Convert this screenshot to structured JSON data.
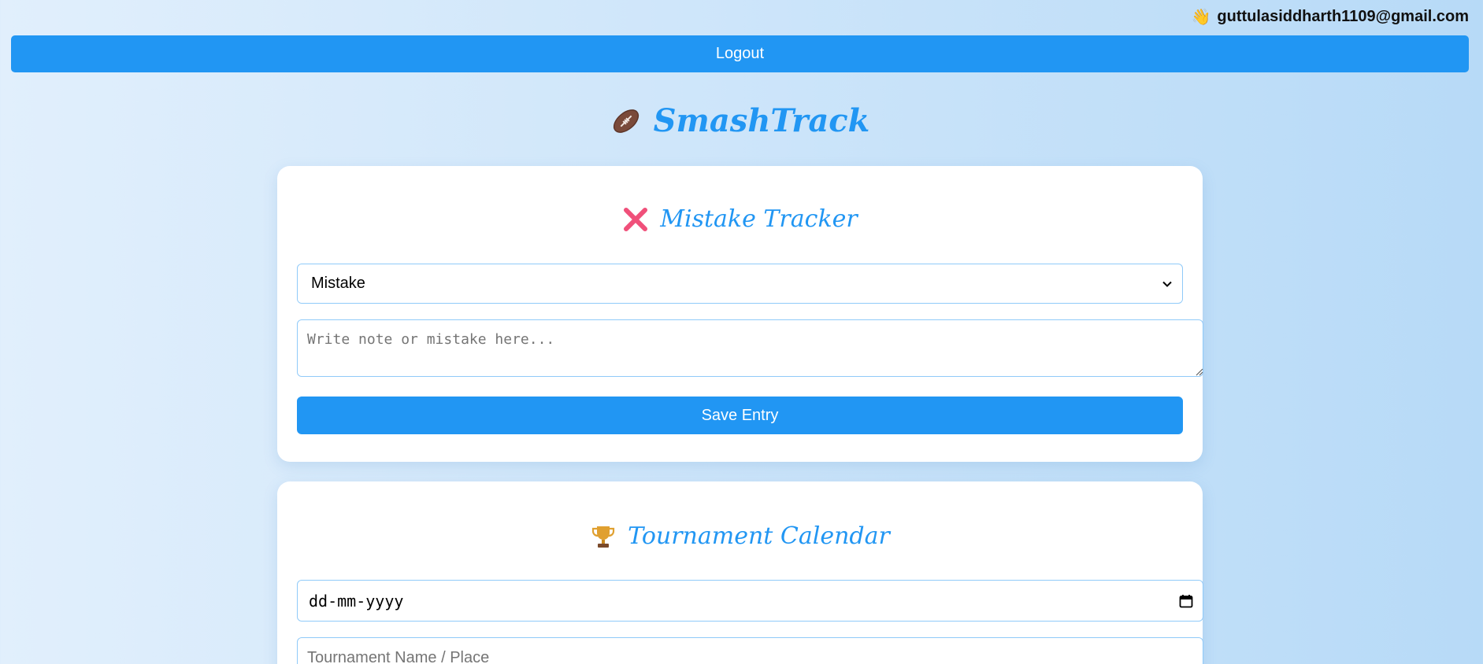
{
  "user": {
    "wave_icon": "👋",
    "email": "guttulasiddharth1109@gmail.com"
  },
  "logout_label": "Logout",
  "app": {
    "title": "SmashTrack",
    "icon": "football-icon"
  },
  "mistake_tracker": {
    "title": "Mistake Tracker",
    "icon": "cross-mark-icon",
    "type_select": {
      "selected": "Mistake"
    },
    "note": {
      "value": "",
      "placeholder": "Write note or mistake here..."
    },
    "save_label": "Save Entry"
  },
  "tournament_calendar": {
    "title": "Tournament Calendar",
    "icon": "trophy-icon",
    "date_input": {
      "placeholder": "dd-mm-yyyy"
    },
    "name_input": {
      "value": "",
      "placeholder": "Tournament Name / Place"
    }
  },
  "colors": {
    "accent": "#2196f3",
    "field_border": "#90caf9",
    "cross": "#f0507a",
    "trophy": "#e0a030"
  }
}
